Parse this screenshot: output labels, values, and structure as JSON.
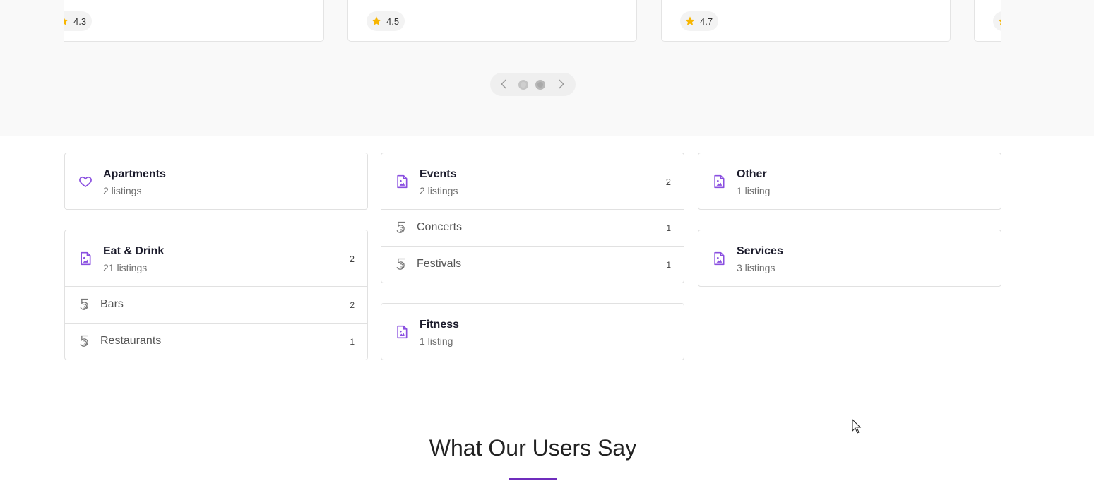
{
  "carousel": {
    "cards": [
      {
        "rating": "4.3"
      },
      {
        "rating": "4.5"
      },
      {
        "rating": "4.7"
      },
      {
        "rating": ""
      }
    ],
    "pager": {
      "pages": 2,
      "active_page": 1
    }
  },
  "categories": {
    "columns": [
      [
        {
          "title": "Apartments",
          "subtitle": "2 listings",
          "count": "",
          "icon": "heart-icon",
          "children": []
        },
        {
          "title": "Eat & Drink",
          "subtitle": "21 listings",
          "count": "2",
          "icon": "file-image-icon",
          "children": [
            {
              "label": "Bars",
              "count": "2",
              "icon": "five-logo-icon"
            },
            {
              "label": "Restaurants",
              "count": "1",
              "icon": "five-logo-icon"
            }
          ]
        }
      ],
      [
        {
          "title": "Events",
          "subtitle": "2 listings",
          "count": "2",
          "icon": "file-image-icon",
          "children": [
            {
              "label": "Concerts",
              "count": "1",
              "icon": "five-logo-icon"
            },
            {
              "label": "Festivals",
              "count": "1",
              "icon": "five-logo-icon"
            }
          ]
        },
        {
          "title": "Fitness",
          "subtitle": "1 listing",
          "count": "",
          "icon": "file-image-icon",
          "children": []
        }
      ],
      [
        {
          "title": "Other",
          "subtitle": "1 listing",
          "count": "",
          "icon": "file-image-icon",
          "children": []
        },
        {
          "title": "Services",
          "subtitle": "3 listings",
          "count": "",
          "icon": "file-image-icon",
          "children": []
        }
      ]
    ]
  },
  "testimonials": {
    "title": "What Our Users Say"
  },
  "colors": {
    "accent": "#8a4fe0",
    "star": "#f7b500",
    "underline": "#6f2dbd"
  }
}
